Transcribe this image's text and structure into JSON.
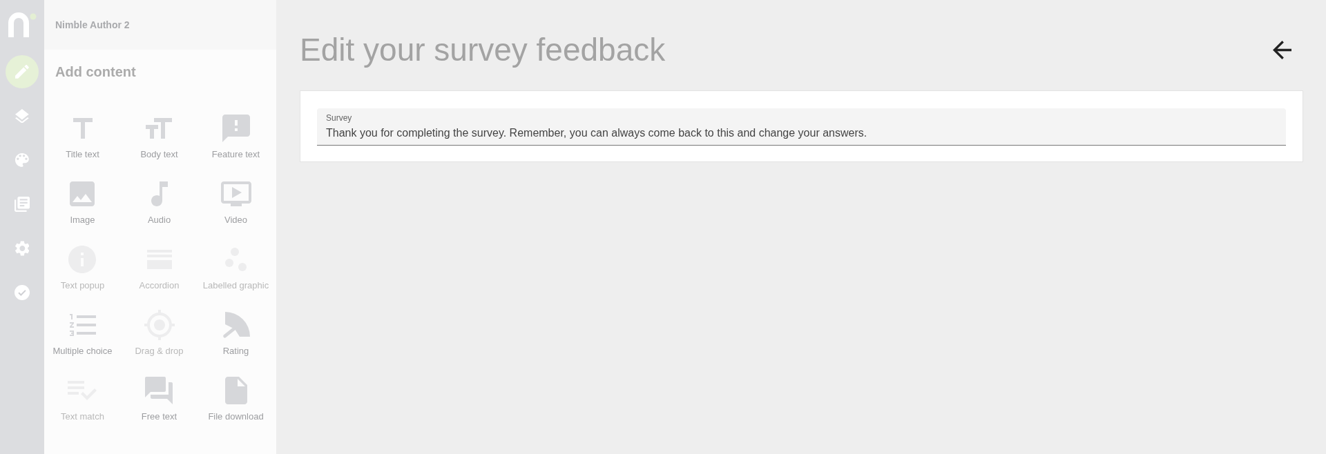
{
  "rail": {
    "items": [
      {
        "kind": "edit",
        "selected": true
      },
      {
        "kind": "layers",
        "selected": false
      },
      {
        "kind": "palette",
        "selected": false
      },
      {
        "kind": "library",
        "selected": false
      },
      {
        "kind": "settings",
        "selected": false
      },
      {
        "kind": "check",
        "selected": false
      }
    ]
  },
  "sidebar": {
    "app_name": "Nimble Author 2",
    "heading": "Add content",
    "tiles": [
      {
        "kind": "title",
        "label": "Title text",
        "disabled": false
      },
      {
        "kind": "body",
        "label": "Body text",
        "disabled": false
      },
      {
        "kind": "feature",
        "label": "Feature text",
        "disabled": false
      },
      {
        "kind": "image",
        "label": "Image",
        "disabled": false
      },
      {
        "kind": "audio",
        "label": "Audio",
        "disabled": false
      },
      {
        "kind": "video",
        "label": "Video",
        "disabled": false
      },
      {
        "kind": "popup",
        "label": "Text popup",
        "disabled": true
      },
      {
        "kind": "accordion",
        "label": "Accordion",
        "disabled": true
      },
      {
        "kind": "hotspot",
        "label": "Labelled graphic",
        "disabled": true
      },
      {
        "kind": "choice",
        "label": "Multiple choice",
        "disabled": false
      },
      {
        "kind": "dragdrop",
        "label": "Drag & drop",
        "disabled": true
      },
      {
        "kind": "rating",
        "label": "Rating",
        "disabled": false
      },
      {
        "kind": "match",
        "label": "Text match",
        "disabled": true
      },
      {
        "kind": "freetext",
        "label": "Free text",
        "disabled": false
      },
      {
        "kind": "file",
        "label": "File download",
        "disabled": false
      }
    ]
  },
  "main": {
    "title": "Edit your survey feedback",
    "field": {
      "label": "Survey",
      "value": "Thank you for completing the survey. Remember, you can always come back to this and change your answers."
    }
  }
}
